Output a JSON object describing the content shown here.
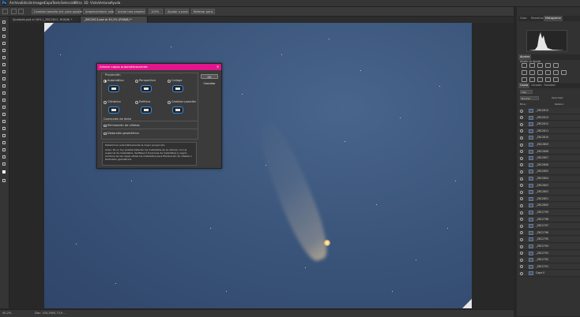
{
  "menu": {
    "logo": "Ps",
    "items": [
      "Archivo",
      "Edición",
      "Imagen",
      "Capa",
      "Texto",
      "Selección",
      "Filtro",
      "3D",
      "Vista",
      "Ventana",
      "Ayuda"
    ]
  },
  "options": {
    "sample_size_label": "Cambiar tamaño ctrl. para ajustar",
    "sample_label": "Ampliar/reducir solo",
    "auto_label": "Ancho tras ampliar",
    "b1": "100%",
    "b2": "Ajustar a pant.",
    "b3": "Rellenar pant."
  },
  "tabs": [
    {
      "label": "Ajustada.psd al 16% (_Z6C2812, RGB/8) *",
      "active": false
    },
    {
      "label": "_Z6C2813.psd al 40,2% (RGB/8) *",
      "active": true
    }
  ],
  "statusbar": {
    "zoom": "40,2%",
    "doc": "Doc: 103,2M/0,73,9..."
  },
  "panels": {
    "top_tabs": [
      "Color",
      "Muestras",
      "Histograma"
    ],
    "adjust_title": "Ajustes",
    "adjust_sub": "Añadir un ajuste",
    "layer_tabs": [
      "Capas",
      "Canales",
      "Trazados"
    ],
    "filter_label": "Tipo",
    "blend_mode": "Normal",
    "opacity_label": "Opacidad:",
    "lock_label": "Bloq.:",
    "fill_label": "Relleno:",
    "layers": [
      "_Z6C2814",
      "_Z6C2813",
      "_Z6C2812",
      "_Z6C2811",
      "_Z6C2810",
      "_Z6C2809",
      "_Z6C2808",
      "_Z6C2807",
      "_Z6C2806",
      "_Z6C2805",
      "_Z6C2804",
      "_Z6C2803",
      "_Z6C2802",
      "_Z6C2801",
      "_Z6C2800",
      "_Z6C2799",
      "_Z6C2798",
      "_Z6C2797",
      "_Z6C2796",
      "_Z6C2795",
      "_Z6C2794",
      "_Z6C2793",
      "_Z6C2792",
      "_Z6C2791",
      "Capa 0"
    ]
  },
  "dialog": {
    "title": "Alinear capas automáticamente",
    "projection_title": "Proyección",
    "options": [
      "Automático",
      "Perspectiva",
      "Collage",
      "Cilíndrico",
      "Esférico",
      "Cambiar posición"
    ],
    "selected": "Automático",
    "lens_title": "Corrección de lente",
    "vignette": "Eliminación de viñetas",
    "geometric": "Distorsión geométrica",
    "info": "Determinar automáticamente la mejor proyección.",
    "info2": "Aviso: Es un fuy posible detectar los metadatos de la cámara. Con la ausencia de metadatos. Verifique lí funciones de metadatos () según archivos de las capas utiliza los metadatos para Eliminación de viñetas o Distorsión geométrica.",
    "ok": "OK",
    "cancel": "Cancelar"
  },
  "colors": {
    "accent": "#e2168b",
    "canvas": "#3b557b"
  }
}
